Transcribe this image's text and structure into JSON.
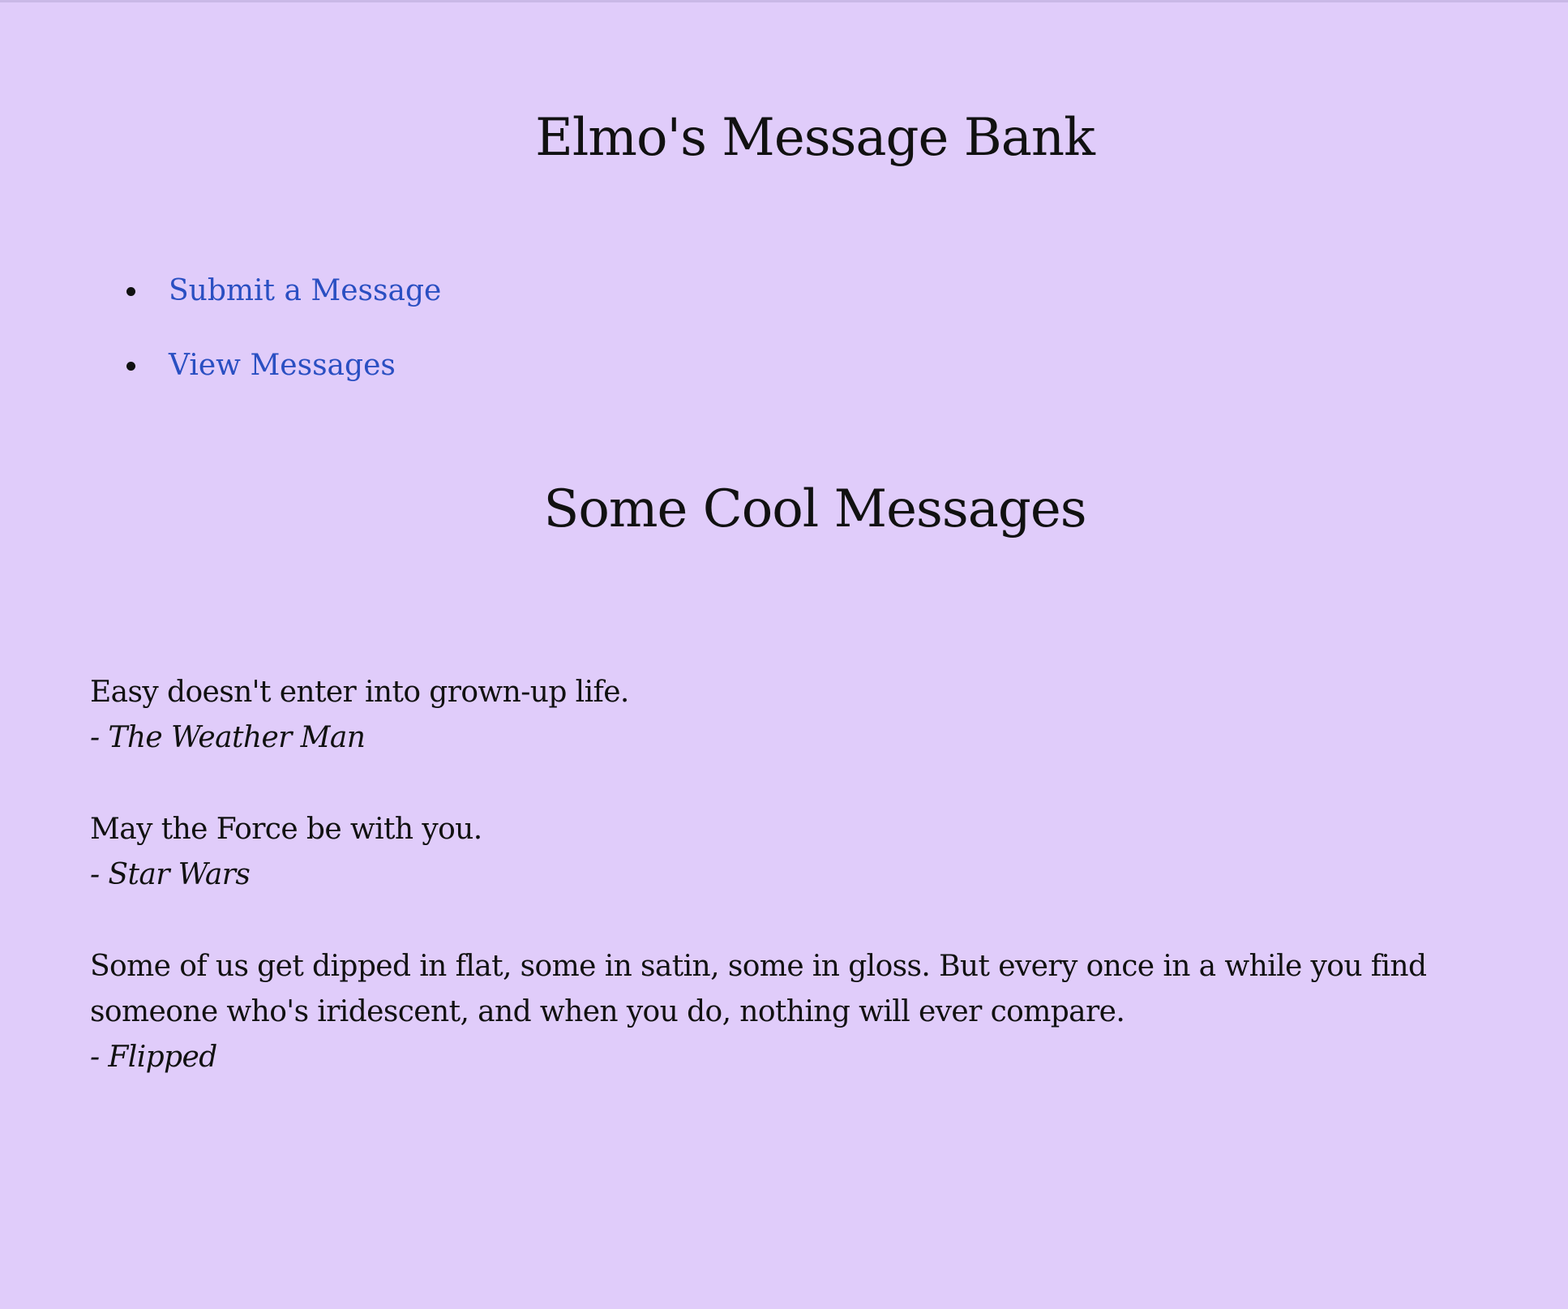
{
  "header": {
    "title": "Elmo's Message Bank"
  },
  "nav": {
    "items": [
      {
        "label": "Submit a Message"
      },
      {
        "label": "View Messages"
      }
    ]
  },
  "main": {
    "section_title": "Some Cool Messages",
    "messages": [
      {
        "text": "Easy doesn't enter into grown-up life.",
        "author": "- The Weather Man"
      },
      {
        "text": "May the Force be with you.",
        "author": "- Star Wars"
      },
      {
        "text": "Some of us get dipped in flat, some in satin, some in gloss. But every once in a while you find someone who's iridescent, and when you do, nothing will ever compare.",
        "author": "- Flipped"
      }
    ]
  },
  "colors": {
    "background": "#e0ccfa",
    "link": "#2a4fc2",
    "text": "#111111"
  }
}
